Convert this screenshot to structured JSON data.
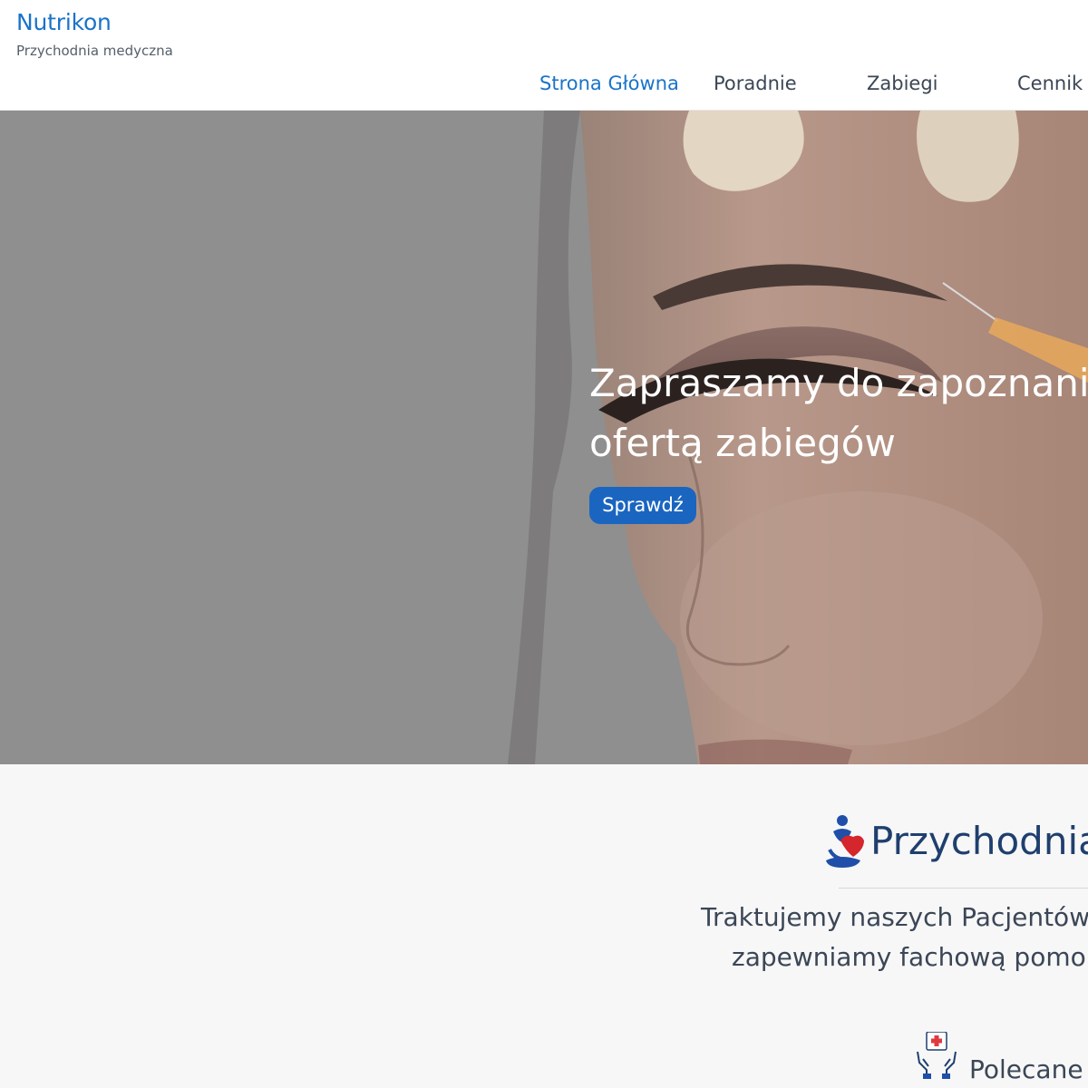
{
  "header": {
    "brand": "Nutrikon",
    "tagline": "Przychodnia medyczna",
    "nav": [
      {
        "label": "Strona Główna",
        "active": true
      },
      {
        "label": "Poradnie",
        "active": false
      },
      {
        "label": "Zabiegi",
        "active": false
      },
      {
        "label": "Cennik",
        "active": false
      }
    ]
  },
  "hero": {
    "heading_lines": [
      "Zapraszamy do zapoznania",
      "ofertą zabiegów"
    ],
    "cta_label": "Sprawdź"
  },
  "intro": {
    "title": "Przychodnia",
    "text_lines": [
      "Traktujemy naszych Pacjentów",
      "zapewniamy fachową pomo"
    ],
    "subheading": "Polecane"
  },
  "icons": {
    "clinic_logo": "clinic-logo-icon",
    "care": "caring-hands-icon"
  },
  "colors": {
    "accent": "#1a73c9",
    "button": "#1a65c0",
    "heading": "#1f3f6e",
    "text": "#3b4656"
  }
}
